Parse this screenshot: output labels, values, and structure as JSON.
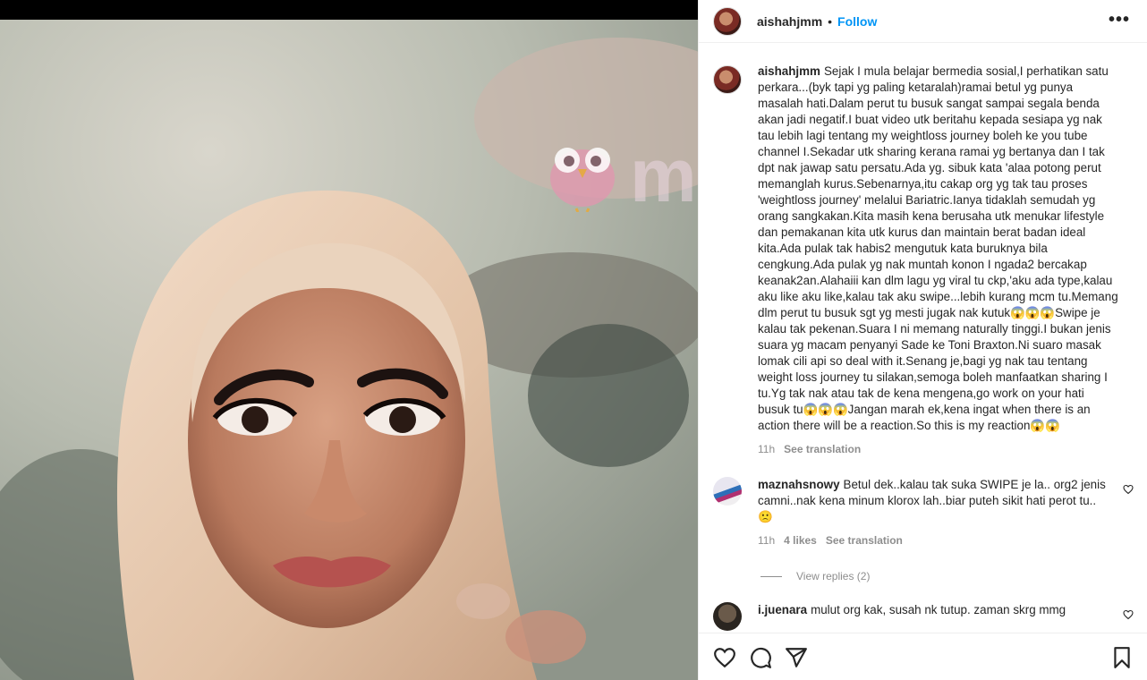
{
  "post": {
    "username": "aishahjmm",
    "separator": "•",
    "follow_label": "Follow",
    "more_label": "•••"
  },
  "media": {
    "watermark_text": "mutah"
  },
  "caption": {
    "username": "aishahjmm",
    "text": "Sejak I mula belajar bermedia sosial,I perhatikan satu perkara...(byk tapi yg paling ketaralah)ramai betul yg punya masalah hati.Dalam perut tu busuk sangat sampai segala benda akan jadi negatif.I buat video utk beritahu kepada sesiapa yg nak tau lebih lagi tentang my weightloss journey boleh ke you tube channel I.Sekadar utk sharing kerana ramai yg bertanya dan I tak dpt nak jawap satu persatu.Ada yg. sibuk kata 'alaa potong perut memanglah kurus.Sebenarnya,itu cakap org yg tak tau proses 'weightloss journey' melalui Bariatric.Ianya tidaklah semudah yg orang sangkakan.Kita masih kena berusaha utk menukar lifestyle dan pemakanan kita utk kurus dan maintain berat badan ideal kita.Ada pulak tak habis2 mengutuk kata buruknya bila cengkung.Ada pulak yg nak muntah konon I ngada2 bercakap keanak2an.Alahaiii kan dlm lagu yg viral tu ckp,'aku ada type,kalau aku like aku like,kalau tak aku swipe...lebih kurang mcm tu.Memang dlm perut tu busuk sgt yg mesti jugak nak kutuk😱😱😱Swipe je kalau tak pekenan.Suara I ni memang naturally tinggi.I bukan jenis suara yg macam penyanyi Sade ke Toni Braxton.Ni suaro masak lomak cili api so deal with it.Senang je,bagi yg nak tau tentang weight loss journey tu silakan,semoga boleh manfaatkan sharing I tu.Yg tak nak atau tak de kena mengena,go work on your hati busuk tu😱😱😱Jangan marah ek,kena ingat when there is an action there will be a reaction.So this is my reaction😱😱",
    "time": "11h",
    "see_translation": "See translation"
  },
  "comments": [
    {
      "username": "maznahsnowy",
      "text": "Betul dek..kalau tak suka SWIPE je la.. org2 jenis camni..nak kena minum klorox lah..biar puteh sikit hati perot tu..🙁",
      "time": "11h",
      "likes": "4 likes",
      "see_translation": "See translation",
      "view_replies": "View replies (2)"
    },
    {
      "username": "i.juenara",
      "text": "mulut org kak, susah nk tutup. zaman skrg mmg"
    }
  ],
  "icons": {
    "like": "heart-icon",
    "comment": "comment-icon",
    "share": "paper-plane-icon",
    "save": "bookmark-icon",
    "more": "more-dots-icon"
  },
  "colors": {
    "follow_blue": "#0095f6",
    "text": "#262626",
    "muted": "#8e8e8e",
    "divider": "#efefef"
  }
}
